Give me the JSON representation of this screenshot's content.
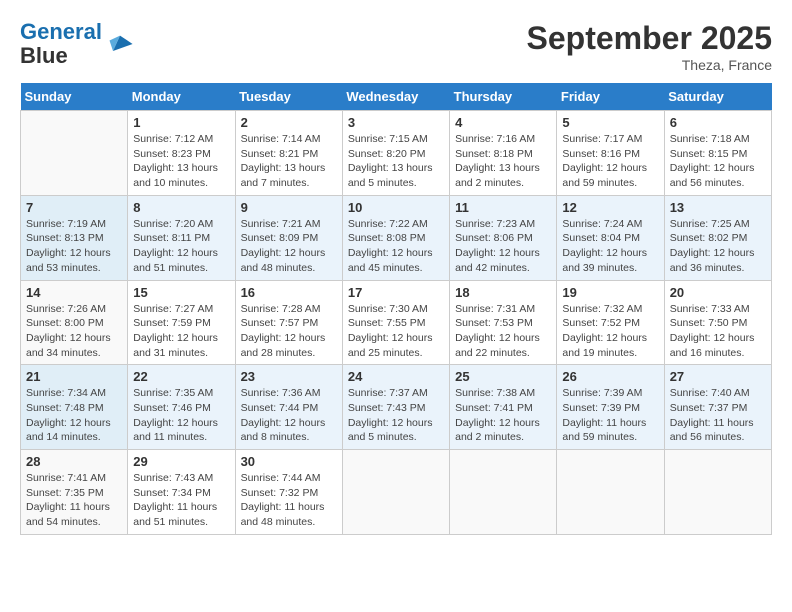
{
  "header": {
    "logo_line1": "General",
    "logo_line2": "Blue",
    "month": "September 2025",
    "location": "Theza, France"
  },
  "weekdays": [
    "Sunday",
    "Monday",
    "Tuesday",
    "Wednesday",
    "Thursday",
    "Friday",
    "Saturday"
  ],
  "weeks": [
    [
      null,
      {
        "day": 1,
        "sunrise": "7:12 AM",
        "sunset": "8:23 PM",
        "daylight": "13 hours and 10 minutes."
      },
      {
        "day": 2,
        "sunrise": "7:14 AM",
        "sunset": "8:21 PM",
        "daylight": "13 hours and 7 minutes."
      },
      {
        "day": 3,
        "sunrise": "7:15 AM",
        "sunset": "8:20 PM",
        "daylight": "13 hours and 5 minutes."
      },
      {
        "day": 4,
        "sunrise": "7:16 AM",
        "sunset": "8:18 PM",
        "daylight": "13 hours and 2 minutes."
      },
      {
        "day": 5,
        "sunrise": "7:17 AM",
        "sunset": "8:16 PM",
        "daylight": "12 hours and 59 minutes."
      },
      {
        "day": 6,
        "sunrise": "7:18 AM",
        "sunset": "8:15 PM",
        "daylight": "12 hours and 56 minutes."
      }
    ],
    [
      {
        "day": 7,
        "sunrise": "7:19 AM",
        "sunset": "8:13 PM",
        "daylight": "12 hours and 53 minutes."
      },
      {
        "day": 8,
        "sunrise": "7:20 AM",
        "sunset": "8:11 PM",
        "daylight": "12 hours and 51 minutes."
      },
      {
        "day": 9,
        "sunrise": "7:21 AM",
        "sunset": "8:09 PM",
        "daylight": "12 hours and 48 minutes."
      },
      {
        "day": 10,
        "sunrise": "7:22 AM",
        "sunset": "8:08 PM",
        "daylight": "12 hours and 45 minutes."
      },
      {
        "day": 11,
        "sunrise": "7:23 AM",
        "sunset": "8:06 PM",
        "daylight": "12 hours and 42 minutes."
      },
      {
        "day": 12,
        "sunrise": "7:24 AM",
        "sunset": "8:04 PM",
        "daylight": "12 hours and 39 minutes."
      },
      {
        "day": 13,
        "sunrise": "7:25 AM",
        "sunset": "8:02 PM",
        "daylight": "12 hours and 36 minutes."
      }
    ],
    [
      {
        "day": 14,
        "sunrise": "7:26 AM",
        "sunset": "8:00 PM",
        "daylight": "12 hours and 34 minutes."
      },
      {
        "day": 15,
        "sunrise": "7:27 AM",
        "sunset": "7:59 PM",
        "daylight": "12 hours and 31 minutes."
      },
      {
        "day": 16,
        "sunrise": "7:28 AM",
        "sunset": "7:57 PM",
        "daylight": "12 hours and 28 minutes."
      },
      {
        "day": 17,
        "sunrise": "7:30 AM",
        "sunset": "7:55 PM",
        "daylight": "12 hours and 25 minutes."
      },
      {
        "day": 18,
        "sunrise": "7:31 AM",
        "sunset": "7:53 PM",
        "daylight": "12 hours and 22 minutes."
      },
      {
        "day": 19,
        "sunrise": "7:32 AM",
        "sunset": "7:52 PM",
        "daylight": "12 hours and 19 minutes."
      },
      {
        "day": 20,
        "sunrise": "7:33 AM",
        "sunset": "7:50 PM",
        "daylight": "12 hours and 16 minutes."
      }
    ],
    [
      {
        "day": 21,
        "sunrise": "7:34 AM",
        "sunset": "7:48 PM",
        "daylight": "12 hours and 14 minutes."
      },
      {
        "day": 22,
        "sunrise": "7:35 AM",
        "sunset": "7:46 PM",
        "daylight": "12 hours and 11 minutes."
      },
      {
        "day": 23,
        "sunrise": "7:36 AM",
        "sunset": "7:44 PM",
        "daylight": "12 hours and 8 minutes."
      },
      {
        "day": 24,
        "sunrise": "7:37 AM",
        "sunset": "7:43 PM",
        "daylight": "12 hours and 5 minutes."
      },
      {
        "day": 25,
        "sunrise": "7:38 AM",
        "sunset": "7:41 PM",
        "daylight": "12 hours and 2 minutes."
      },
      {
        "day": 26,
        "sunrise": "7:39 AM",
        "sunset": "7:39 PM",
        "daylight": "11 hours and 59 minutes."
      },
      {
        "day": 27,
        "sunrise": "7:40 AM",
        "sunset": "7:37 PM",
        "daylight": "11 hours and 56 minutes."
      }
    ],
    [
      {
        "day": 28,
        "sunrise": "7:41 AM",
        "sunset": "7:35 PM",
        "daylight": "11 hours and 54 minutes."
      },
      {
        "day": 29,
        "sunrise": "7:43 AM",
        "sunset": "7:34 PM",
        "daylight": "11 hours and 51 minutes."
      },
      {
        "day": 30,
        "sunrise": "7:44 AM",
        "sunset": "7:32 PM",
        "daylight": "11 hours and 48 minutes."
      },
      null,
      null,
      null,
      null
    ]
  ],
  "labels": {
    "sunrise": "Sunrise:",
    "sunset": "Sunset:",
    "daylight": "Daylight:"
  }
}
